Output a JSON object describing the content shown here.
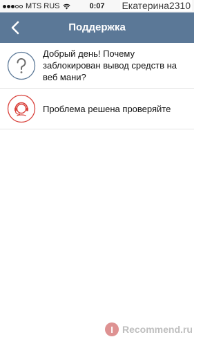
{
  "status_bar": {
    "carrier": "MTS RUS",
    "time": "0:07",
    "signal_icon": "signal-dots-icon",
    "wifi_icon": "wifi-icon"
  },
  "watermark_top": {
    "username": "Екатерина2310"
  },
  "nav": {
    "back_icon": "chevron-left-icon",
    "title": "Поддержка",
    "background": "#5b7897"
  },
  "items": [
    {
      "icon": "question-icon",
      "icon_color": "#5b7897",
      "text": "Добрый день! Почему заблокирован вывод средств на веб мани?"
    },
    {
      "icon": "support-agent-icon",
      "icon_color": "#d9423c",
      "text": "Проблема решена проверяйте"
    }
  ],
  "watermark_bottom": {
    "text": "Recommend.ru",
    "logo_letter": "I"
  }
}
